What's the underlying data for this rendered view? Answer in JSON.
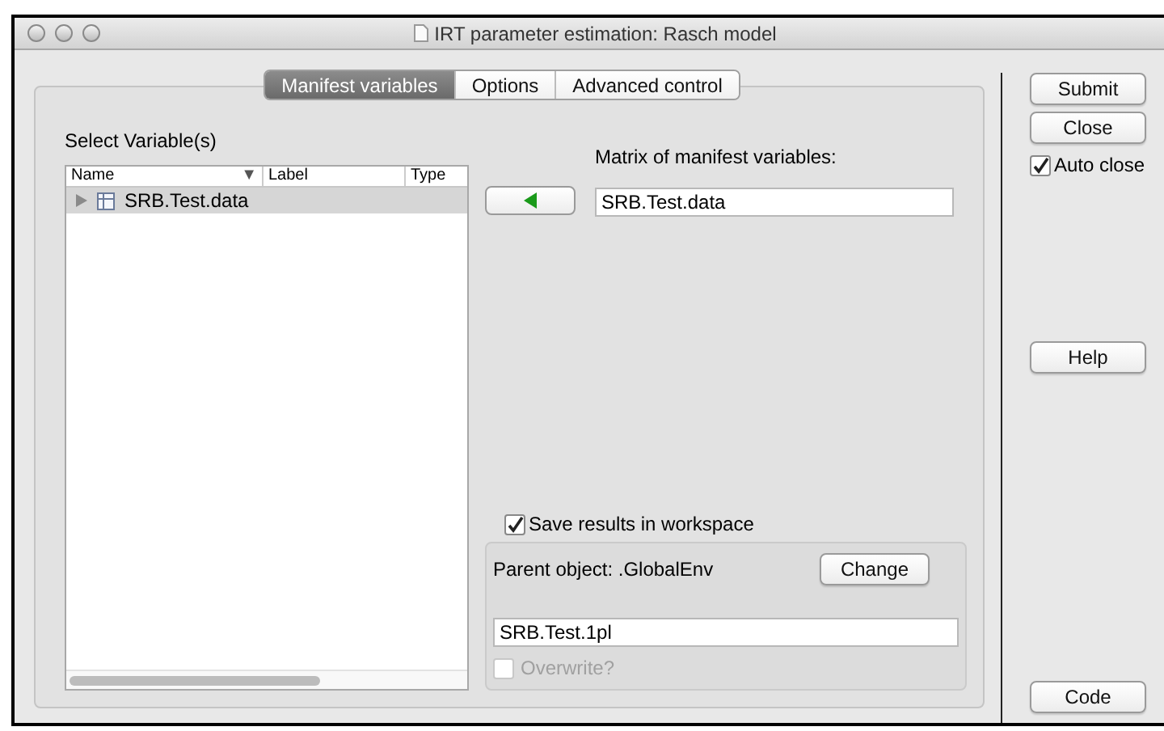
{
  "window": {
    "title": "IRT parameter estimation: Rasch model"
  },
  "tabs": [
    {
      "label": "Manifest variables",
      "selected": true
    },
    {
      "label": "Options",
      "selected": false
    },
    {
      "label": "Advanced control",
      "selected": false
    }
  ],
  "variable_selector": {
    "title": "Select Variable(s)",
    "columns": [
      "Name",
      "Label",
      "Type"
    ],
    "sort_indicator": "▼",
    "rows": [
      {
        "name": "SRB.Test.data",
        "selected": true,
        "expanded": false
      }
    ]
  },
  "matrix": {
    "label": "Matrix of manifest variables:",
    "value": "SRB.Test.data"
  },
  "save": {
    "label": "Save results in workspace",
    "checked": true,
    "parent_label": "Parent object: .GlobalEnv",
    "change_button": "Change",
    "name_value": "SRB.Test.1pl",
    "overwrite": {
      "label": "Overwrite?",
      "checked": false,
      "disabled": true
    }
  },
  "side_buttons": {
    "submit": "Submit",
    "close": "Close",
    "auto_close": {
      "label": "Auto close",
      "checked": true
    },
    "help": "Help",
    "code": "Code"
  }
}
